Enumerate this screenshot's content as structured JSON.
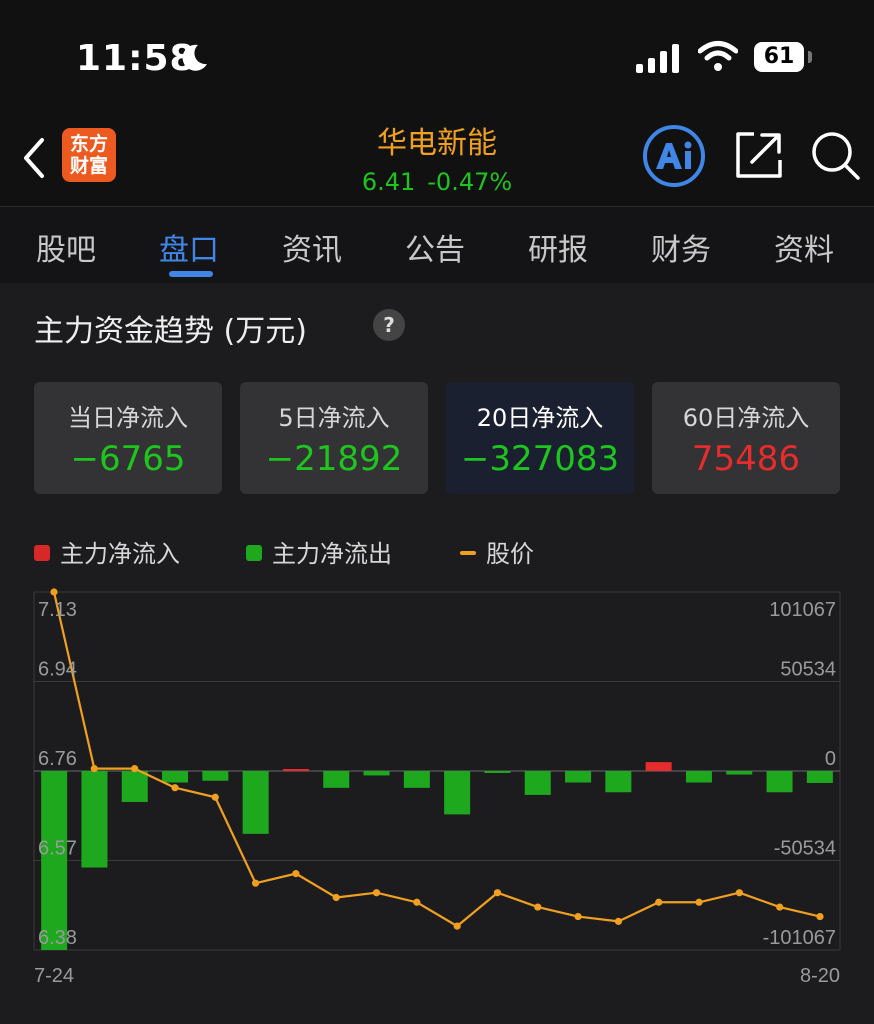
{
  "status": {
    "time": "11:58",
    "battery": "61"
  },
  "header": {
    "stock_name": "华电新能",
    "price": "6.41",
    "change": "-0.47%",
    "logo_line1": "东方",
    "logo_line2": "财富"
  },
  "tabs": [
    {
      "label": "股吧"
    },
    {
      "label": "盘口",
      "active": true
    },
    {
      "label": "资讯"
    },
    {
      "label": "公告"
    },
    {
      "label": "研报"
    },
    {
      "label": "财务"
    },
    {
      "label": "资料"
    }
  ],
  "section": {
    "title": "主力资金趋势 (万元)",
    "help": "?"
  },
  "cards": [
    {
      "label": "当日净流入",
      "value": "−6765"
    },
    {
      "label": "5日净流入",
      "value": "−21892"
    },
    {
      "label": "20日净流入",
      "value": "−327083"
    },
    {
      "label": "60日净流入",
      "value": "75486"
    }
  ],
  "legend": {
    "inflow": "主力净流入",
    "outflow": "主力净流出",
    "price": "股价"
  },
  "colors": {
    "inflow": "#e62c2c",
    "outflow": "#1ea81e",
    "price": "#f0a020",
    "active_tab": "#3f86e6"
  },
  "chart_data": {
    "type": "bar",
    "x_start_label": "7-24",
    "x_end_label": "8-20",
    "left_ticks": [
      "7.13",
      "6.94",
      "6.76",
      "6.57",
      "6.38"
    ],
    "right_ticks": [
      "101067",
      "50534",
      "0",
      "-50534",
      "-101067"
    ],
    "ylim_price": [
      6.38,
      7.13
    ],
    "ylim_flow": [
      -101067,
      101067
    ],
    "grid": true,
    "series": [
      {
        "name": "主力净流入/主力净流出",
        "values": [
          -101067,
          -54500,
          -17500,
          -6500,
          -5500,
          -35500,
          0,
          -9500,
          -2500,
          -9500,
          -24500,
          -500,
          -13500,
          -6500,
          -12000,
          5000,
          -6500,
          -2000,
          -12000,
          -6765
        ]
      },
      {
        "name": "股价",
        "values": [
          7.13,
          6.76,
          6.76,
          6.72,
          6.7,
          6.52,
          6.54,
          6.49,
          6.5,
          6.48,
          6.43,
          6.5,
          6.47,
          6.45,
          6.44,
          6.48,
          6.48,
          6.5,
          6.47,
          6.45
        ]
      }
    ]
  }
}
